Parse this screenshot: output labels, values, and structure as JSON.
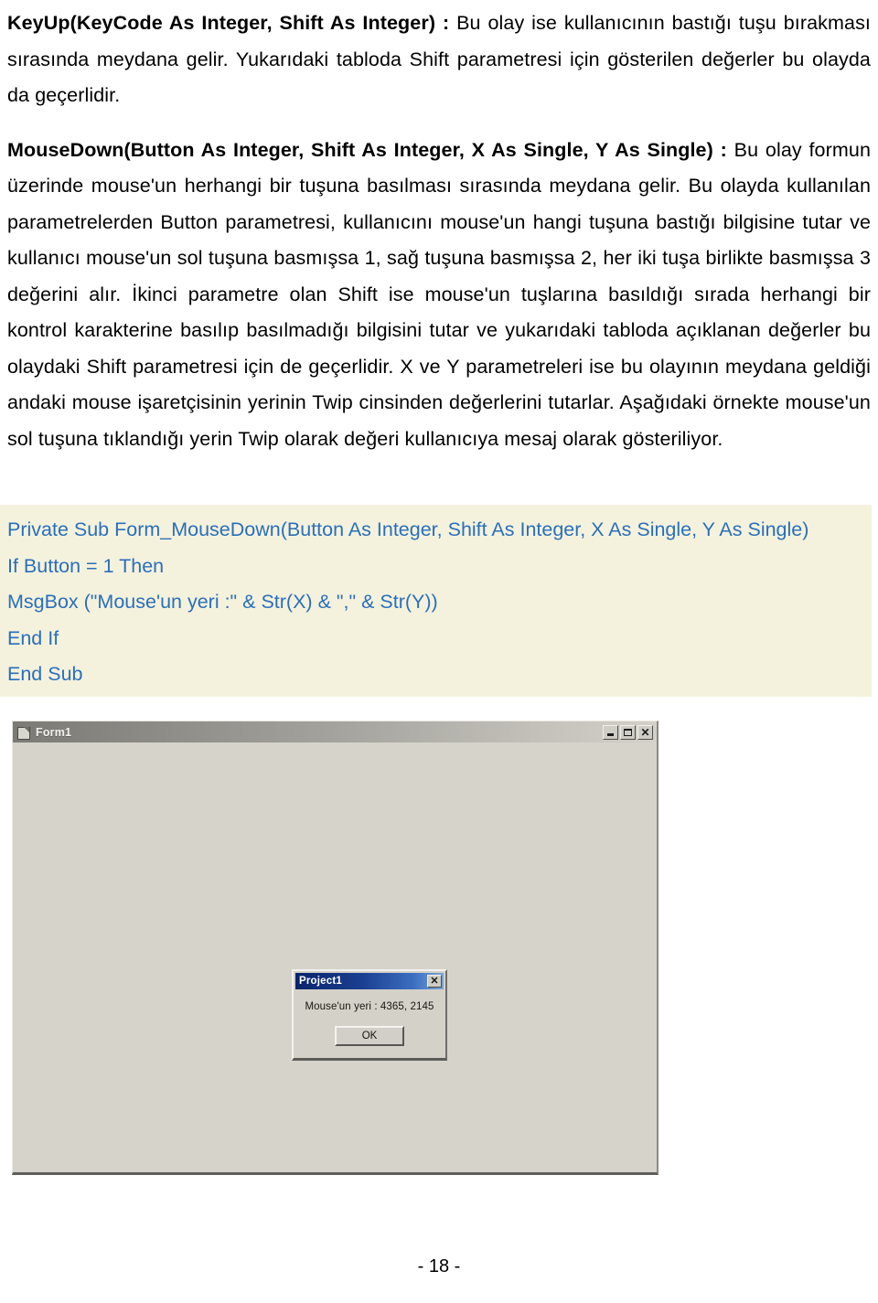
{
  "document": {
    "paragraphs": [
      {
        "id": "keyup-paragraph",
        "heading": "KeyUp(KeyCode As Integer, Shift As Integer) :",
        "body": " Bu olay ise kullanıcının bastığı tuşu bırakması sırasında meydana gelir. Yukarıdaki tabloda Shift parametresi için gösterilen değerler bu olayda da geçerlidir."
      },
      {
        "id": "mousedown-paragraph",
        "heading": "MouseDown(Button As Integer, Shift As Integer, X As Single, Y As Single) :",
        "body": " Bu olay formun üzerinde mouse'un herhangi bir tuşuna basılması sırasında meydana gelir. Bu olayda kullanılan parametrelerden Button parametresi, kullanıcını mouse'un hangi tuşuna bastığı bilgisine tutar ve kullanıcı mouse'un sol tuşuna basmışsa 1, sağ tuşuna basmışsa 2, her iki tuşa birlikte basmışsa 3 değerini alır. İkinci parametre olan Shift ise mouse'un tuşlarına basıldığı sırada herhangi bir kontrol karakterine basılıp basılmadığı bilgisini tutar ve yukarıdaki tabloda açıklanan değerler bu olaydaki Shift parametresi için de geçerlidir. X ve Y parametreleri ise bu olayının meydana geldiği andaki mouse işaretçisinin yerinin Twip cinsinden değerlerini tutarlar. Aşağıdaki örnekte mouse'un sol tuşuna tıklandığı yerin Twip olarak değeri kullanıcıya mesaj olarak gösteriliyor."
      }
    ]
  },
  "code_block": {
    "background_color": "#f4f2dd",
    "text_color": "#2a6fba",
    "lines": [
      "Private Sub Form_MouseDown(Button As Integer, Shift As Integer, X As Single, Y As Single)",
      "If Button = 1 Then",
      "MsgBox (\"Mouse'un yeri :\" & Str(X) & \",\" & Str(Y))",
      "End If",
      "End Sub"
    ]
  },
  "screenshot": {
    "form_window": {
      "title": "Form1",
      "title_icon": "form-document-icon",
      "controls": [
        {
          "name": "minimize",
          "glyph": "_"
        },
        {
          "name": "maximize",
          "glyph": "□"
        },
        {
          "name": "close",
          "glyph": "✕"
        }
      ],
      "background_color": "#d6d3cb"
    },
    "message_box": {
      "title": "Project1",
      "close_glyph": "✕",
      "message": "Mouse'un yeri  : 4365, 2145",
      "ok_label": "OK",
      "titlebar_color": "#0a246a"
    }
  },
  "footer": {
    "page_number": "- 18 -"
  }
}
